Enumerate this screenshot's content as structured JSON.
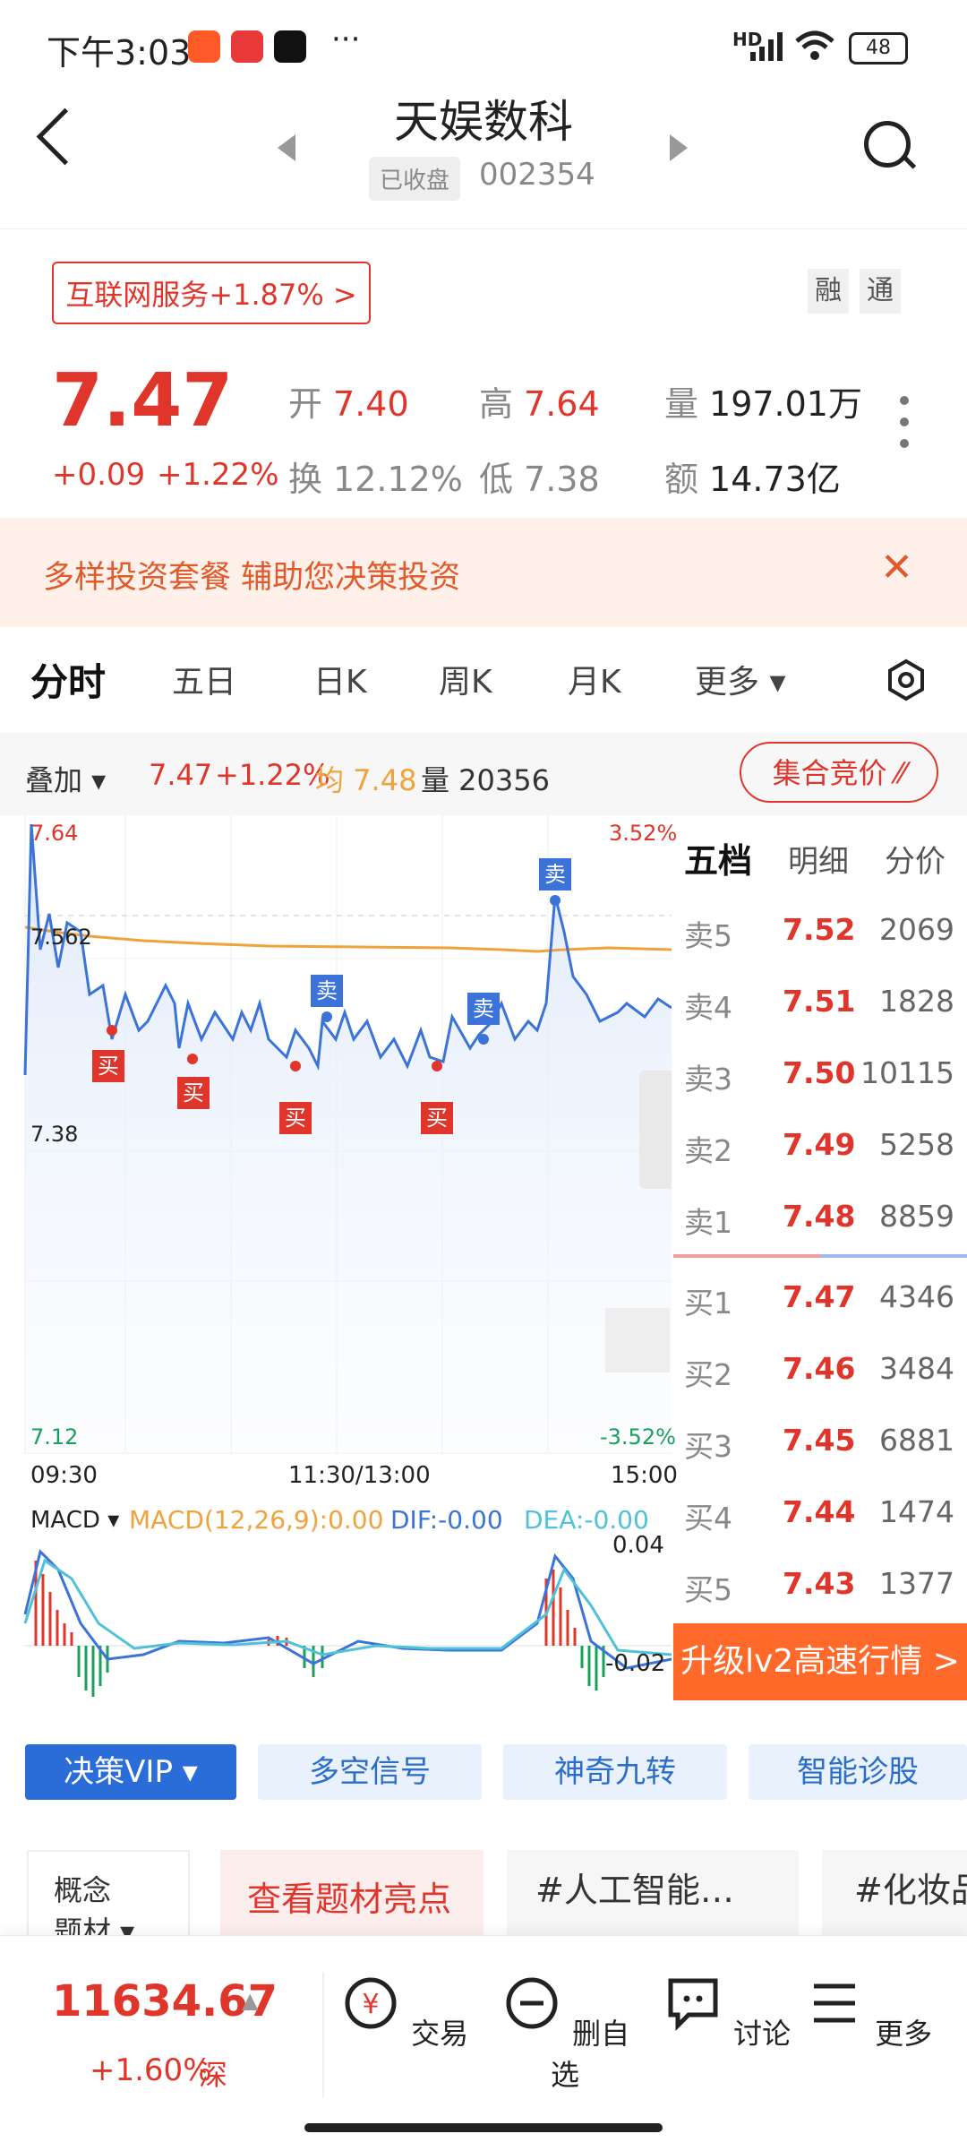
{
  "status_bar": {
    "time": "下午3:03",
    "network": "HD",
    "battery": "48"
  },
  "header": {
    "title": "天娱数科",
    "status": "已收盘",
    "code": "002354"
  },
  "sector": {
    "label": "互联网服务+1.87% >"
  },
  "tags": [
    "融",
    "通"
  ],
  "quote": {
    "price": "7.47",
    "change": "+0.09",
    "change_pct": "+1.22%",
    "open_label": "开",
    "open": "7.40",
    "high_label": "高",
    "high": "7.64",
    "volume_label": "量",
    "volume": "197.01万",
    "turnover_label": "换",
    "turnover": "12.12%",
    "low_label": "低",
    "low": "7.38",
    "amount_label": "额",
    "amount": "14.73亿"
  },
  "promo": {
    "text": "多样投资套餐 辅助您决策投资",
    "close": "✕"
  },
  "tabs": [
    "分时",
    "五日",
    "日K",
    "周K",
    "月K",
    "更多 ▾"
  ],
  "overlay_bar": {
    "overlay": "叠加 ▾",
    "price": "7.47",
    "pct": "+1.22%",
    "avg": "均 7.48",
    "vol": "量 20356",
    "auction": "集合竞价 ⁄⁄"
  },
  "chart_labels": {
    "y_high": "7.64",
    "y_mid": "7.562",
    "y_low_mark": "7.38",
    "y_low": "7.12",
    "pct_high": "3.52%",
    "pct_low": "-3.52%",
    "t_start": "09:30",
    "t_mid": "11:30/13:00",
    "t_end": "15:00",
    "buy": "买",
    "sell": "卖"
  },
  "macd": {
    "label": "MACD ▾",
    "macd": "MACD(12,26,9):0.00",
    "dif": "DIF:-0.00",
    "dea": "DEA:-0.00",
    "top": "0.04",
    "bottom": "-0.02"
  },
  "book": {
    "tabs": [
      "五档",
      "明细",
      "分价"
    ],
    "sells": [
      {
        "name": "卖5",
        "price": "7.52",
        "vol": "2069"
      },
      {
        "name": "卖4",
        "price": "7.51",
        "vol": "1828"
      },
      {
        "name": "卖3",
        "price": "7.50",
        "vol": "10115"
      },
      {
        "name": "卖2",
        "price": "7.49",
        "vol": "5258"
      },
      {
        "name": "卖1",
        "price": "7.48",
        "vol": "8859"
      }
    ],
    "buys": [
      {
        "name": "买1",
        "price": "7.47",
        "vol": "4346"
      },
      {
        "name": "买2",
        "price": "7.46",
        "vol": "3484"
      },
      {
        "name": "买3",
        "price": "7.45",
        "vol": "6881"
      },
      {
        "name": "买4",
        "price": "7.44",
        "vol": "1474"
      },
      {
        "name": "买5",
        "price": "7.43",
        "vol": "1377"
      }
    ],
    "upgrade": "升级lv2高速行情 >"
  },
  "feature_buttons": [
    "决策VIP ▾",
    "多空信号",
    "神奇九转",
    "智能诊股"
  ],
  "concept": {
    "label": "概念",
    "label2": "题材 ▾",
    "cta": "查看题材亮点",
    "tag1": "#人工智能…",
    "tag2": "#化妆品"
  },
  "bottom": {
    "index_value": "11634.67",
    "index_arrow": "▲",
    "index_change": "+1.60%",
    "index_market": "深",
    "nav": [
      "交易",
      "删自选",
      "讨论",
      "更多"
    ]
  },
  "colors": {
    "up": "#e0352b",
    "down": "#1aa05a",
    "accent": "#2b6dd8",
    "avg_line": "#f0a23c",
    "price_line": "#3b73d8"
  }
}
